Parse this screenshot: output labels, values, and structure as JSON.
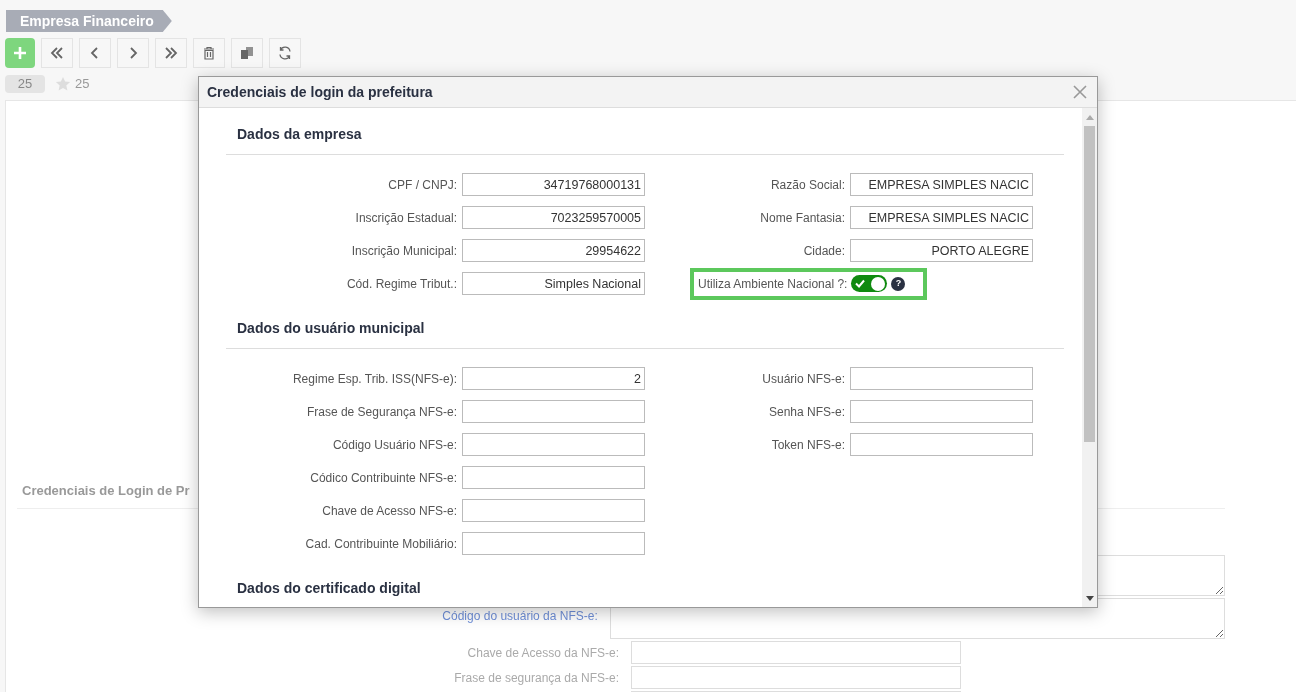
{
  "breadcrumb": "Empresa Financeiro",
  "toolbar": [
    {
      "kind": "add"
    },
    {
      "kind": "first"
    },
    {
      "kind": "prev"
    },
    {
      "kind": "next"
    },
    {
      "kind": "last"
    },
    {
      "kind": "delete"
    },
    {
      "kind": "copy"
    },
    {
      "kind": "refresh"
    }
  ],
  "record_badge": "25",
  "favorites_count": "25",
  "background_form": {
    "title": "Credenciais de Login de Pr",
    "fields": [
      {
        "kind": "textarea"
      },
      {
        "kind": "textarea",
        "label": "Código do usuário da NFS-e:",
        "color": "#6f8fd8"
      },
      {
        "kind": "input",
        "label": "Chave de Acesso da NFS-e:",
        "color": "#aaaaaa"
      },
      {
        "kind": "input",
        "label": "Frase de segurança da NFS-e:",
        "color": "#aaaaaa"
      },
      {
        "kind": "input"
      }
    ]
  },
  "dialog": {
    "title": "Credenciais de login da prefeitura",
    "sections": [
      {
        "title": "Dados da empresa",
        "left": [
          {
            "kind": "input",
            "label": "CPF / CNPJ:",
            "value": "34719768000131"
          },
          {
            "kind": "input",
            "label": "Inscrição Estadual:",
            "value": "7023259570005"
          },
          {
            "kind": "input",
            "label": "Inscrição Municipal:",
            "value": "29954622"
          },
          {
            "kind": "input",
            "label": "Cód. Regime Tribut.:",
            "value": "Simples Nacional"
          }
        ],
        "right": [
          {
            "kind": "input",
            "label": "Razão Social:",
            "value": "EMPRESA SIMPLES NACIC"
          },
          {
            "kind": "input",
            "label": "Nome Fantasia:",
            "value": "EMPRESA SIMPLES NACIC"
          },
          {
            "kind": "input",
            "label": "Cidade:",
            "value": "PORTO ALEGRE"
          },
          {
            "kind": "toggle",
            "label": "Utiliza Ambiente Nacional ?:",
            "on": true,
            "highlighted": true,
            "help": "?"
          }
        ]
      },
      {
        "title": "Dados do usuário municipal",
        "left": [
          {
            "kind": "input",
            "label": "Regime Esp. Trib. ISS(NFS-e):",
            "value": "2"
          },
          {
            "kind": "input",
            "label": "Frase de Segurança NFS-e:"
          },
          {
            "kind": "input",
            "label": "Código Usuário NFS-e:"
          },
          {
            "kind": "input",
            "label": "Códico Contribuinte NFS-e:"
          },
          {
            "kind": "input",
            "label": "Chave de Acesso NFS-e:"
          },
          {
            "kind": "input",
            "label": "Cad. Contribuinte Mobiliário:"
          }
        ],
        "right": [
          {
            "kind": "input",
            "label": "Usuário NFS-e:"
          },
          {
            "kind": "input",
            "label": "Senha NFS-e:"
          },
          {
            "kind": "input",
            "label": "Token NFS-e:"
          }
        ]
      },
      {
        "title": "Dados do certificado digital"
      }
    ]
  }
}
